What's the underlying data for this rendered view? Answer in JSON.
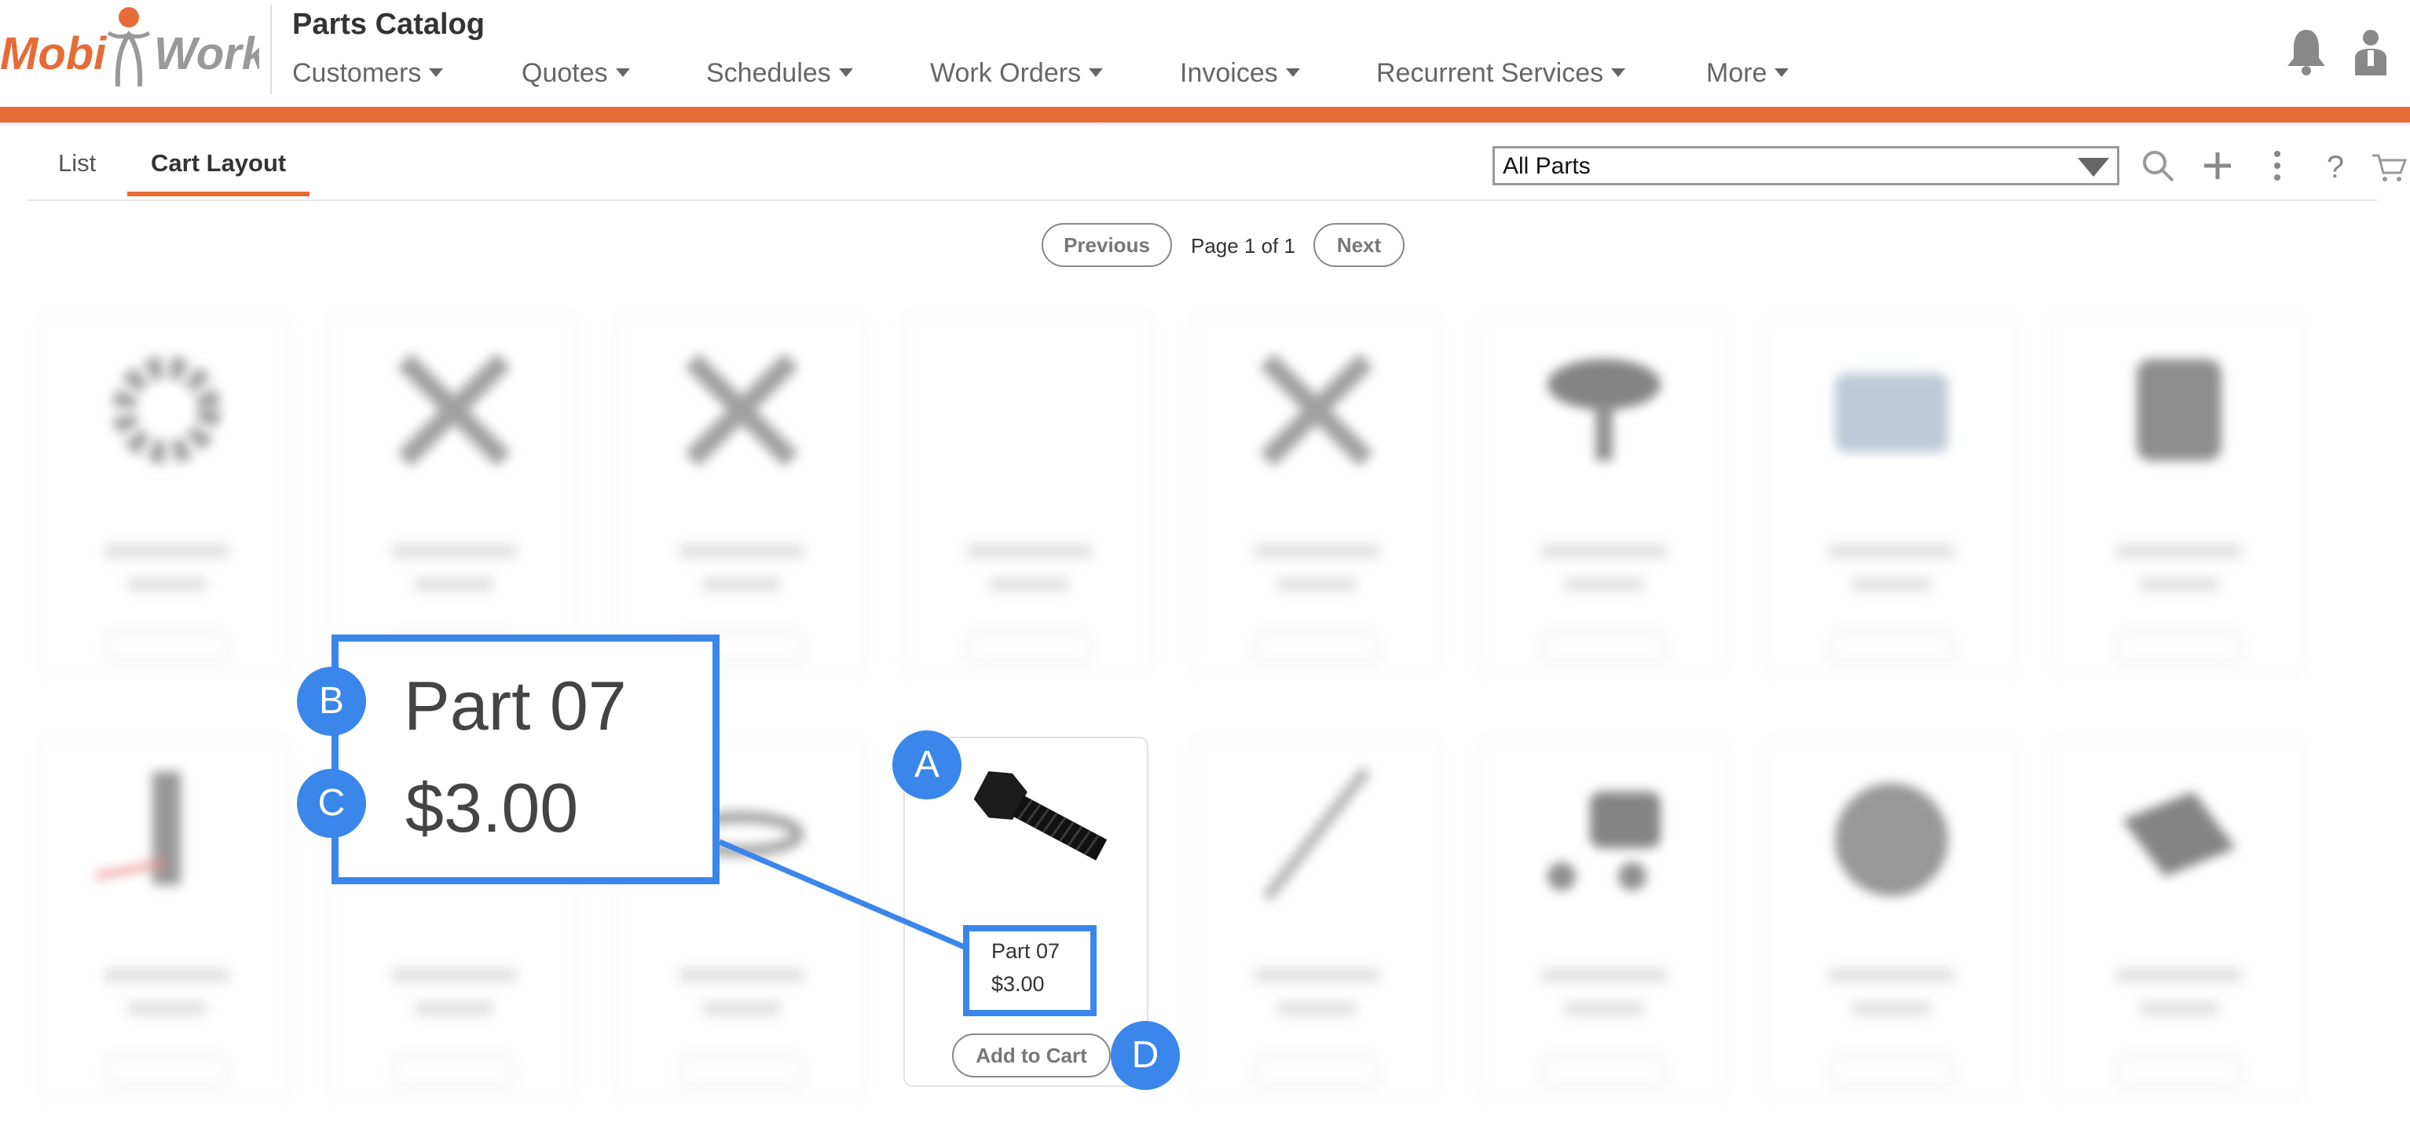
{
  "header": {
    "logo_text_left": "Mobi",
    "logo_text_right": "Work",
    "app_title": "Parts Catalog",
    "nav": [
      {
        "label": "Customers"
      },
      {
        "label": "Quotes"
      },
      {
        "label": "Schedules"
      },
      {
        "label": "Work Orders"
      },
      {
        "label": "Invoices"
      },
      {
        "label": "Recurrent Services"
      },
      {
        "label": "More"
      }
    ],
    "icons": [
      "bell-icon",
      "user-icon"
    ]
  },
  "tabs": [
    {
      "label": "List",
      "active": false
    },
    {
      "label": "Cart Layout",
      "active": true
    }
  ],
  "toolbar": {
    "filter_value": "All Parts",
    "icons": [
      "search-icon",
      "plus-icon",
      "more-vertical-icon",
      "help-icon",
      "cart-icon"
    ]
  },
  "pagination": {
    "previous_label": "Previous",
    "page_text": "Page 1 of 1",
    "next_label": "Next"
  },
  "featured_part": {
    "name": "Part 07",
    "price": "$3.00",
    "add_label": "Add to Cart"
  },
  "callouts": {
    "zoom_name": "Part 07",
    "zoom_price": "$3.00",
    "labels": [
      "A",
      "B",
      "C",
      "D"
    ]
  },
  "colors": {
    "accent_orange": "#e66c37",
    "callout_blue": "#3a86ea"
  }
}
